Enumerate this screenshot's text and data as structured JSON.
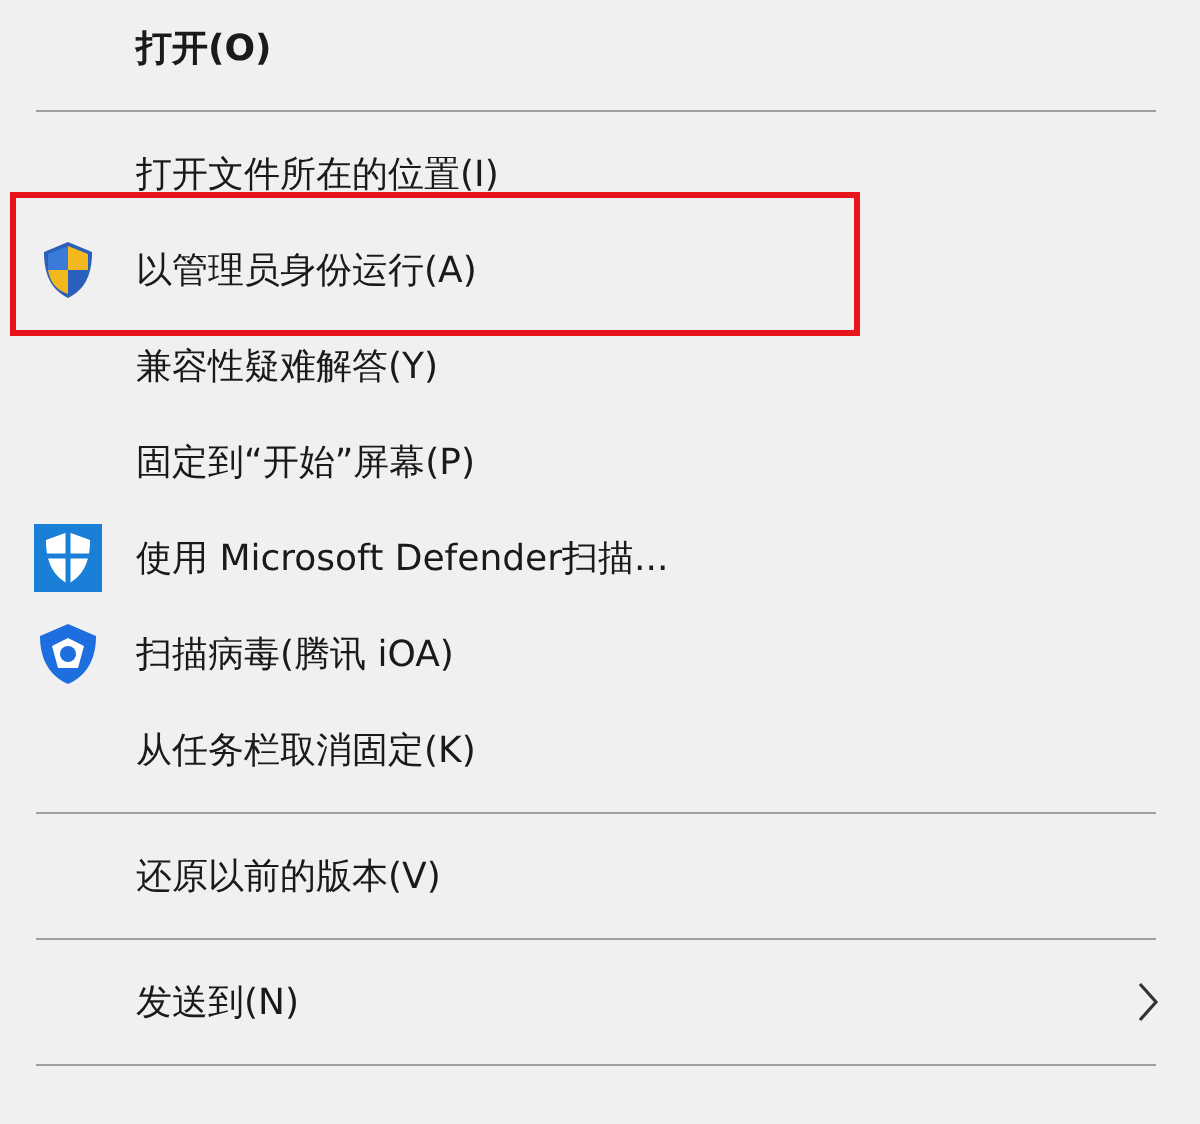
{
  "menu": [
    {
      "kind": "item",
      "label": "打开(O)",
      "default": true
    },
    {
      "kind": "separator"
    },
    {
      "kind": "item",
      "label": "打开文件所在的位置(I)",
      "default": false
    },
    {
      "kind": "shield_item",
      "label": "以管理员身份运行(A)",
      "default": false,
      "highlighted": true
    },
    {
      "kind": "item",
      "label": "兼容性疑难解答(Y)",
      "default": false
    },
    {
      "kind": "item",
      "label": "固定到“开始”屏幕(P)",
      "default": false
    },
    {
      "kind": "defender_item",
      "label": "使用 Microsoft Defender扫描...",
      "default": false
    },
    {
      "kind": "antivirus_item",
      "label": "扫描病毒(腾讯 iOA)",
      "default": false
    },
    {
      "kind": "item",
      "label": "从任务栏取消固定(K)",
      "default": false
    },
    {
      "kind": "separator"
    },
    {
      "kind": "item",
      "label": "还原以前的版本(V)",
      "default": false
    },
    {
      "kind": "separator"
    },
    {
      "kind": "item",
      "label": "发送到(N)",
      "default": false,
      "submenu": true
    },
    {
      "kind": "separator"
    }
  ]
}
